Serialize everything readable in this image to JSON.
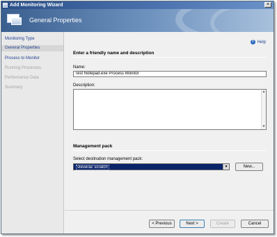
{
  "window": {
    "title": "Add Monitoring Wizard",
    "close_glyph": "×"
  },
  "header": {
    "title": "General Properties"
  },
  "sidebar": {
    "items": [
      {
        "label": "Monitoring Type",
        "state": "enabled"
      },
      {
        "label": "General Properties",
        "state": "selected"
      },
      {
        "label": "Process to Monitor",
        "state": "enabled"
      },
      {
        "label": "Running Processes",
        "state": "disabled"
      },
      {
        "label": "Performance Data",
        "state": "disabled"
      },
      {
        "label": "Summary",
        "state": "disabled"
      }
    ]
  },
  "help": {
    "label": "Help",
    "icon": "help-icon"
  },
  "form": {
    "section_title": "Enter a friendly name and description",
    "name_label": "Name:",
    "name_value": "Test Notepad.exe Process Monitor",
    "description_label": "Description:",
    "description_value": "",
    "management_pack_title": "Management pack",
    "mp_select_label": "Select destination management pack:",
    "mp_selected": "steverac scratch",
    "new_button": "New..."
  },
  "footer": {
    "previous": "< Previous",
    "next": "Next >",
    "create": "Create",
    "cancel": "Cancel"
  }
}
